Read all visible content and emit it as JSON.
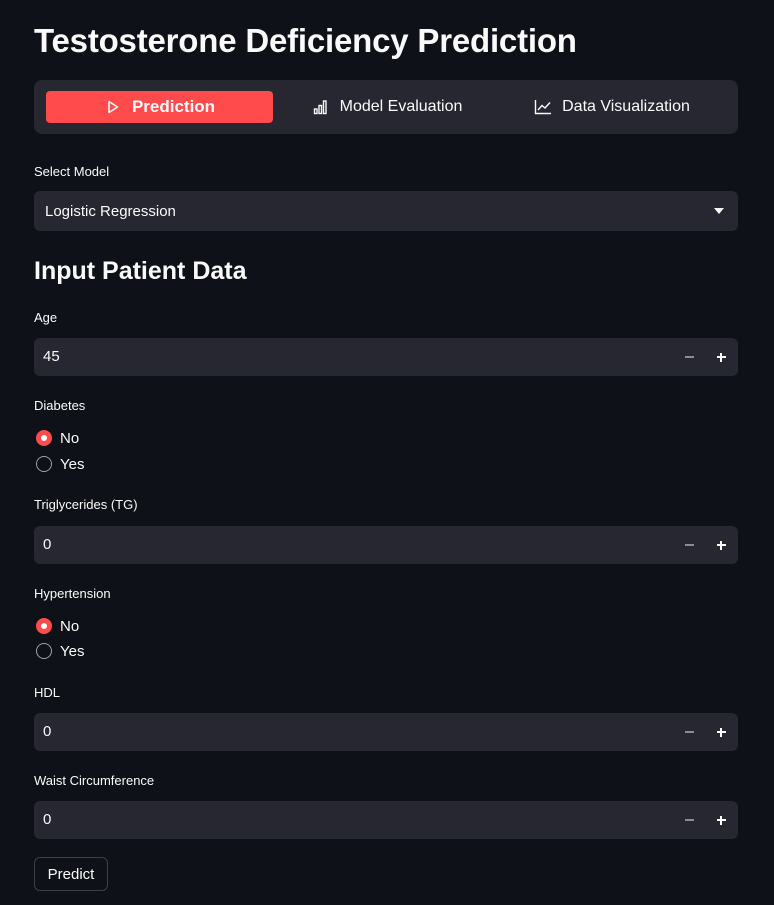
{
  "page": {
    "title": "Testosterone Deficiency Prediction"
  },
  "tabs": [
    {
      "label": "Prediction",
      "icon": "play-icon",
      "active": true
    },
    {
      "label": "Model Evaluation",
      "icon": "bar-chart-icon",
      "active": false
    },
    {
      "label": "Data Visualization",
      "icon": "line-chart-icon",
      "active": false
    }
  ],
  "model_select": {
    "label": "Select Model",
    "value": "Logistic Regression"
  },
  "section": {
    "title": "Input Patient Data"
  },
  "fields": {
    "age": {
      "label": "Age",
      "value": "45"
    },
    "diabetes": {
      "label": "Diabetes",
      "options": [
        "No",
        "Yes"
      ],
      "selected": "No"
    },
    "tg": {
      "label": "Triglycerides (TG)",
      "value": "0"
    },
    "hypertension": {
      "label": "Hypertension",
      "options": [
        "No",
        "Yes"
      ],
      "selected": "No"
    },
    "hdl": {
      "label": "HDL",
      "value": "0"
    },
    "waist": {
      "label": "Waist Circumference",
      "value": "0"
    }
  },
  "actions": {
    "predict_label": "Predict"
  },
  "colors": {
    "accent": "#ff4b4b",
    "background": "#0e1117",
    "surface": "#262730",
    "text": "#fafafa"
  }
}
